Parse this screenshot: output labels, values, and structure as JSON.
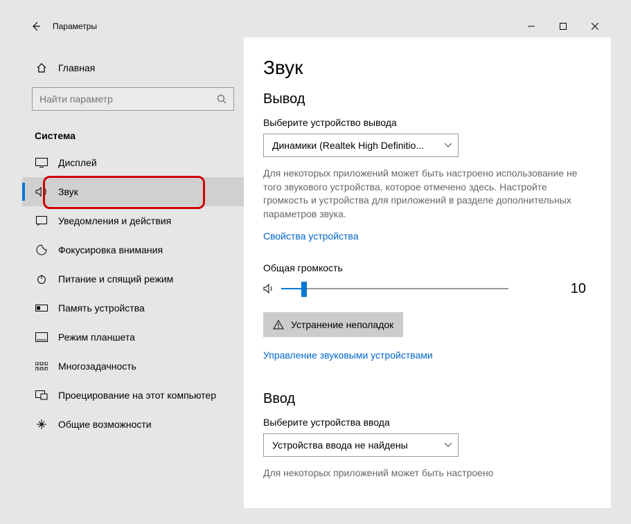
{
  "titlebar": {
    "title": "Параметры"
  },
  "home_label": "Главная",
  "search_placeholder": "Найти параметр",
  "section_title": "Система",
  "nav": [
    {
      "key": "display",
      "label": "Дисплей"
    },
    {
      "key": "sound",
      "label": "Звук"
    },
    {
      "key": "notifications",
      "label": "Уведомления и действия"
    },
    {
      "key": "focus",
      "label": "Фокусировка внимания"
    },
    {
      "key": "power",
      "label": "Питание и спящий режим"
    },
    {
      "key": "storage",
      "label": "Память устройства"
    },
    {
      "key": "tablet",
      "label": "Режим планшета"
    },
    {
      "key": "multitask",
      "label": "Многозадачность"
    },
    {
      "key": "project",
      "label": "Проецирование на этот компьютер"
    },
    {
      "key": "shared",
      "label": "Общие возможности"
    }
  ],
  "main": {
    "title": "Звук",
    "output_section": "Вывод",
    "output_device_label": "Выберите устройство вывода",
    "output_device_value": "Динамики (Realtek High Definitio...",
    "output_hint": "Для некоторых приложений может быть настроено использование не того звукового устройства, которое отмечено здесь. Настройте громкость и устройства для приложений в разделе дополнительных параметров звука.",
    "device_props": "Свойства устройства",
    "master_volume_label": "Общая громкость",
    "volume_value": "10",
    "troubleshoot_label": "Устранение неполадок",
    "manage_devices": "Управление звуковыми устройствами",
    "input_section": "Ввод",
    "input_device_label": "Выберите устройства ввода",
    "input_device_value": "Устройства ввода не найдены",
    "input_hint": "Для некоторых приложений может быть настроено"
  }
}
